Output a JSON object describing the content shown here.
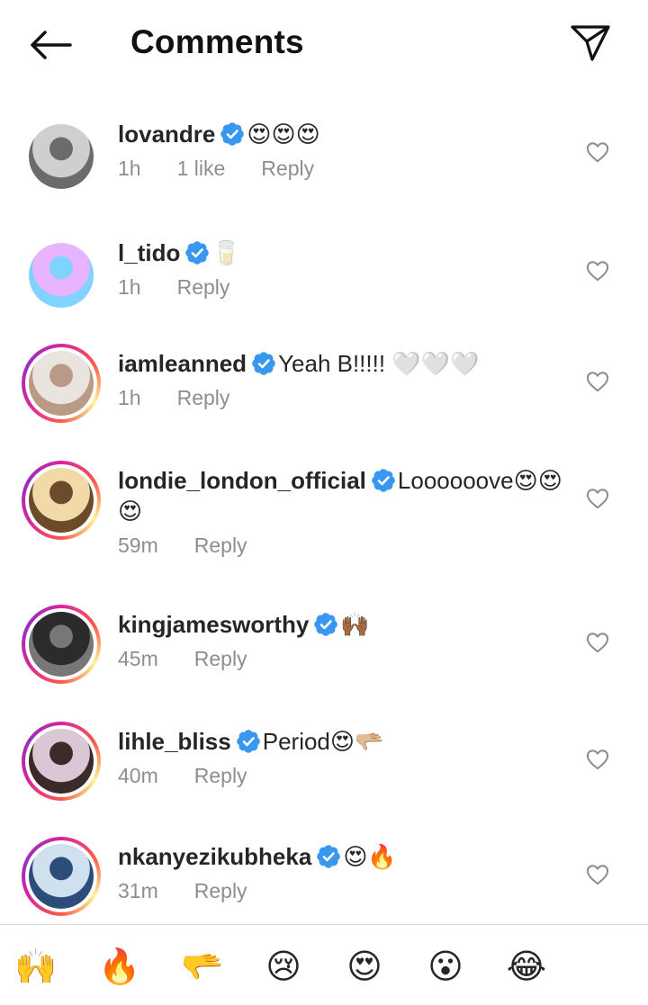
{
  "header": {
    "title": "Comments",
    "back_icon": "arrow-left-icon",
    "send_icon": "paper-plane-icon"
  },
  "colors": {
    "verified": "#3897f0",
    "meta_text": "#8e8e8e",
    "username_text": "#262626"
  },
  "comments": [
    {
      "username": "lovandre",
      "verified": true,
      "text": "😍😍😍",
      "time": "1h",
      "likes": "1 like",
      "reply": "Reply",
      "story_ring": false
    },
    {
      "username": "l_tido",
      "verified": true,
      "text": "🥛",
      "time": "1h",
      "likes": "",
      "reply": "Reply",
      "story_ring": false
    },
    {
      "username": "iamleanned",
      "verified": true,
      "text": "Yeah B!!!!! 🤍🤍🤍",
      "time": "1h",
      "likes": "",
      "reply": "Reply",
      "story_ring": true
    },
    {
      "username": "londie_london_official",
      "verified": true,
      "text": "Loooooove😍😍😍",
      "time": "59m",
      "likes": "",
      "reply": "Reply",
      "story_ring": true
    },
    {
      "username": "kingjamesworthy",
      "verified": true,
      "text": "🙌🏾",
      "time": "45m",
      "likes": "",
      "reply": "Reply",
      "story_ring": true
    },
    {
      "username": "lihle_bliss",
      "verified": true,
      "text": "Period😍🫳🏼",
      "time": "40m",
      "likes": "",
      "reply": "Reply",
      "story_ring": true
    },
    {
      "username": "nkanyezikubheka",
      "verified": true,
      "text": "😍🔥",
      "time": "31m",
      "likes": "",
      "reply": "Reply",
      "story_ring": true
    }
  ],
  "quick_emojis": [
    "🙌",
    "🔥",
    "🫳",
    "😢",
    "😍",
    "😮",
    "😂"
  ]
}
